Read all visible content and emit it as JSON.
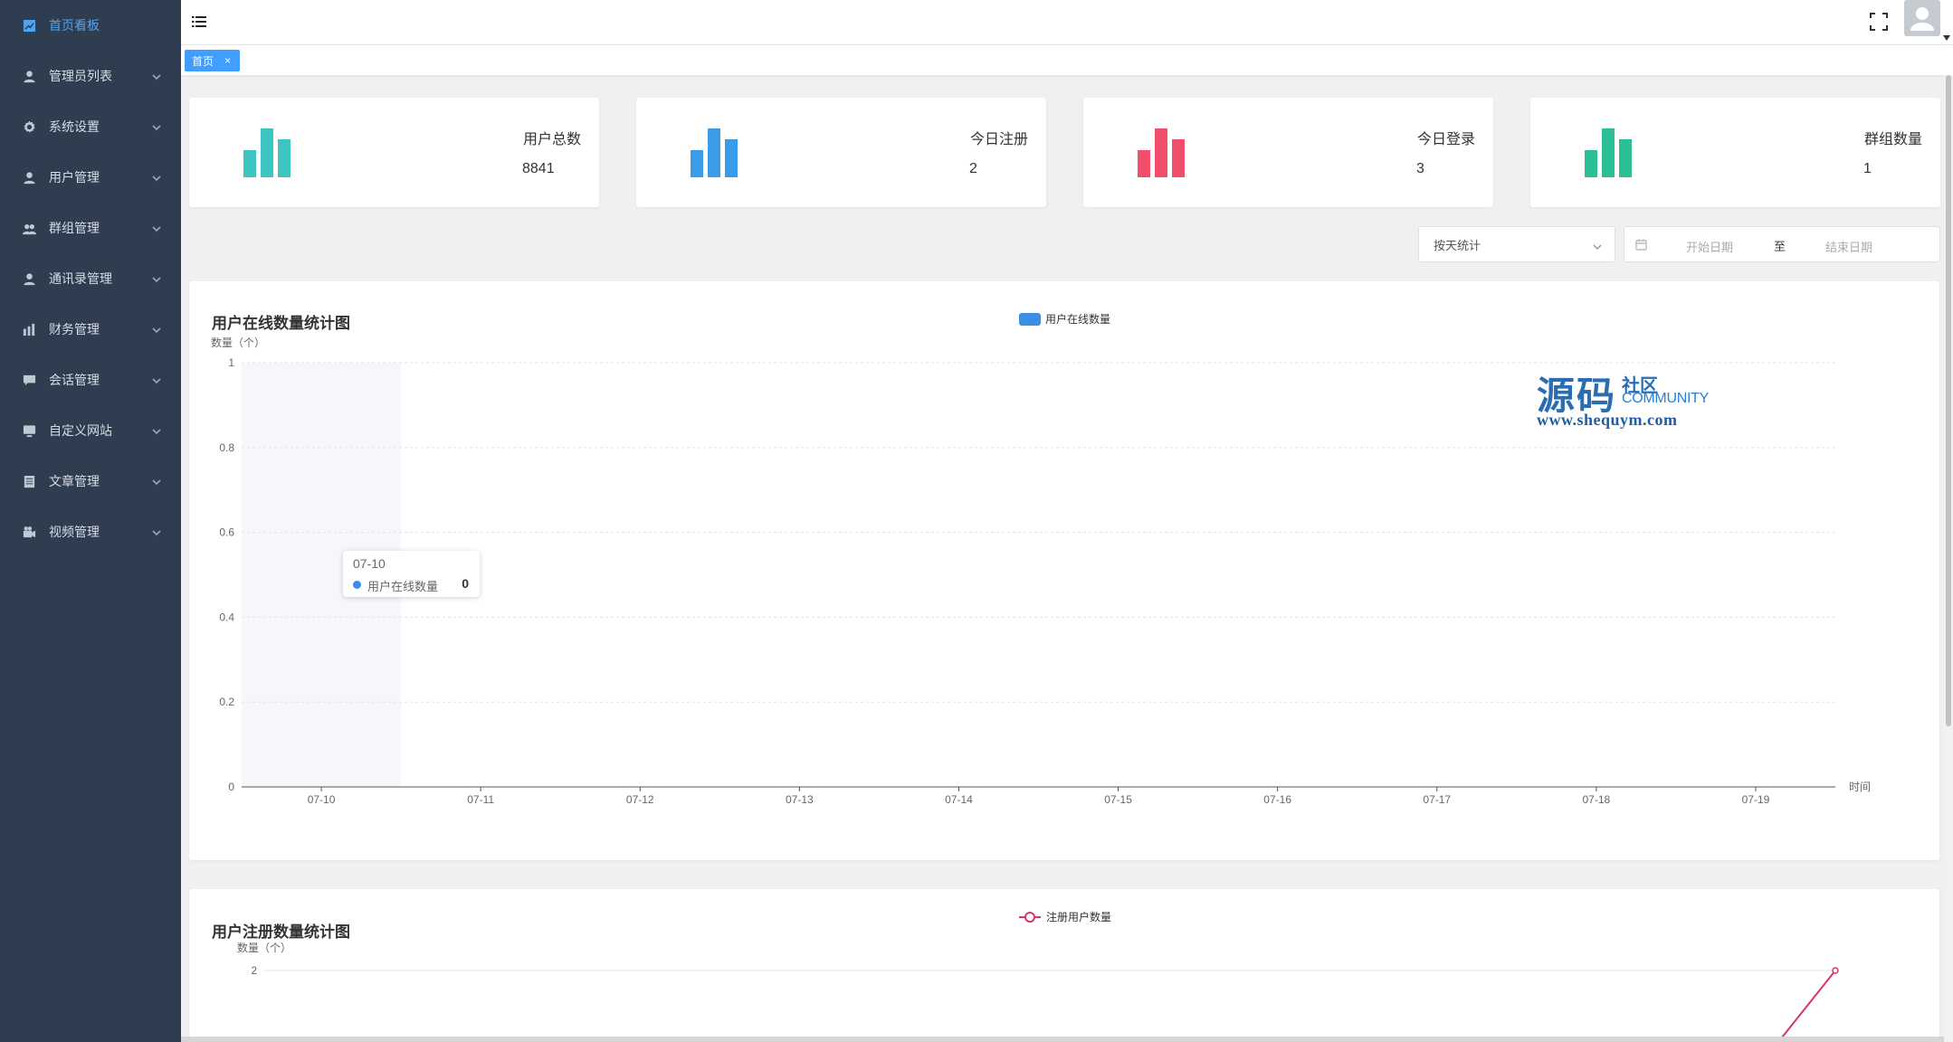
{
  "sidebar": {
    "items": [
      {
        "label": "首页看板",
        "icon": "chart-icon",
        "active": true
      },
      {
        "label": "管理员列表",
        "icon": "user-icon"
      },
      {
        "label": "系统设置",
        "icon": "gear-icon"
      },
      {
        "label": "用户管理",
        "icon": "user-icon"
      },
      {
        "label": "群组管理",
        "icon": "group-icon"
      },
      {
        "label": "通讯录管理",
        "icon": "contact-icon"
      },
      {
        "label": "财务管理",
        "icon": "finance-icon"
      },
      {
        "label": "会话管理",
        "icon": "chat-icon"
      },
      {
        "label": "自定义网站",
        "icon": "monitor-icon"
      },
      {
        "label": "文章管理",
        "icon": "document-icon"
      },
      {
        "label": "视频管理",
        "icon": "video-icon"
      }
    ]
  },
  "tabs": [
    {
      "label": "首页",
      "close": "×"
    }
  ],
  "stats": [
    {
      "label": "用户总数",
      "value": "8841",
      "color": "#3ec5c2"
    },
    {
      "label": "今日注册",
      "value": "2",
      "color": "#3a9be8"
    },
    {
      "label": "今日登录",
      "value": "3",
      "color": "#ef4f6b"
    },
    {
      "label": "群组数量",
      "value": "1",
      "color": "#2cbf96"
    }
  ],
  "filters": {
    "stat_mode": "按天统计",
    "start_placeholder": "开始日期",
    "separator": "至",
    "end_placeholder": "结束日期"
  },
  "watermark": {
    "big": "源码",
    "small": "社区",
    "community": "COMMUNITY",
    "url": "www.shequym.com"
  },
  "tooltip": {
    "date": "07-10",
    "series": "用户在线数量",
    "value": "0"
  },
  "chart_data": [
    {
      "type": "bar",
      "title": "用户在线数量统计图",
      "ylabel": "数量（个）",
      "xlabel": "时间",
      "categories": [
        "07-10",
        "07-11",
        "07-12",
        "07-13",
        "07-14",
        "07-15",
        "07-16",
        "07-17",
        "07-18",
        "07-19"
      ],
      "series": [
        {
          "name": "用户在线数量",
          "values": [
            0,
            0,
            0,
            0,
            0,
            0,
            0,
            0,
            0,
            0
          ],
          "color": "#3a8ee6"
        }
      ],
      "ylim": [
        0,
        1
      ],
      "yticks": [
        "0",
        "0.2",
        "0.4",
        "0.6",
        "0.8",
        "1"
      ],
      "legend": "top-center",
      "grid": true
    },
    {
      "type": "line",
      "title": "用户注册数量统计图",
      "ylabel": "数量（个）",
      "series": [
        {
          "name": "注册用户数量",
          "color": "#d6336c"
        }
      ],
      "yticks": [
        "2"
      ],
      "last_value": 2,
      "legend": "top-center",
      "grid": true
    }
  ]
}
